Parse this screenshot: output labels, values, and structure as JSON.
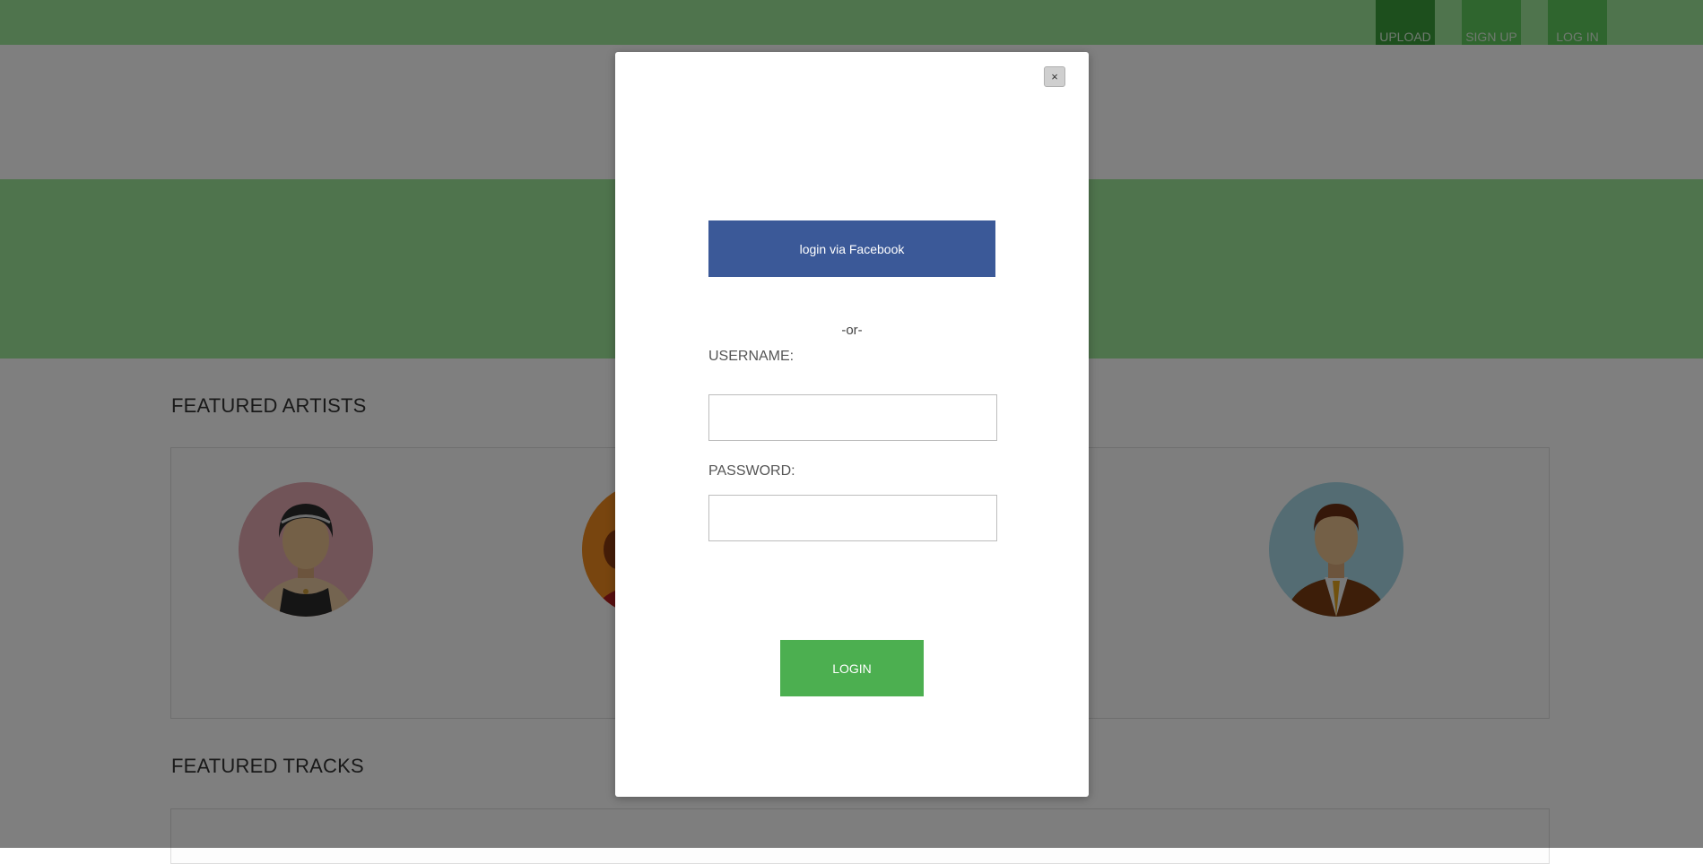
{
  "nav": {
    "upload": "UPLOAD",
    "signup": "SIGN UP",
    "login": "LOG IN"
  },
  "sections": {
    "featured_artists": "FEATURED ARTISTS",
    "featured_tracks": "FEATURED TRACKS"
  },
  "modal": {
    "close_label": "×",
    "facebook_label": "login via Facebook",
    "or_text": "-or-",
    "username_label": "USERNAME:",
    "password_label": "PASSWORD:",
    "username_value": "",
    "password_value": "",
    "login_label": "LOGIN"
  },
  "colors": {
    "facebook": "#3b5998",
    "login_button": "#4caf50",
    "header_green": "#9ee89a"
  }
}
